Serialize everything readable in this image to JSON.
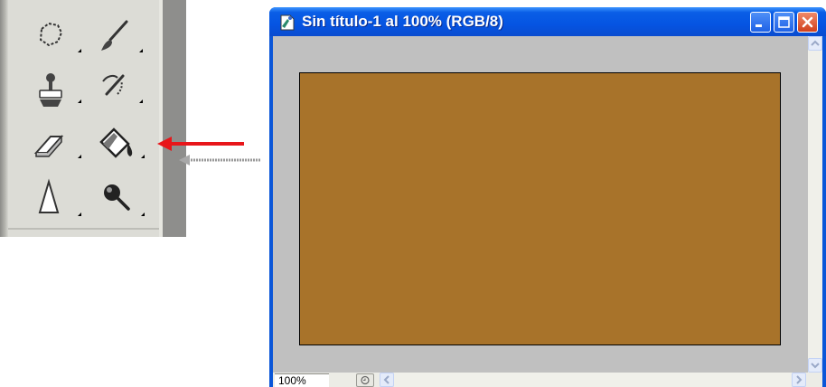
{
  "toolbox": {
    "tools": [
      {
        "icon": "polygon-lasso-icon",
        "has_submenu": true
      },
      {
        "icon": "brush-icon",
        "has_submenu": true
      },
      {
        "icon": "clone-stamp-icon",
        "has_submenu": true
      },
      {
        "icon": "history-brush-icon",
        "has_submenu": true
      },
      {
        "icon": "eraser-icon",
        "has_submenu": true
      },
      {
        "icon": "paint-bucket-icon",
        "has_submenu": true,
        "highlighted": true
      },
      {
        "icon": "blur-icon",
        "has_submenu": true
      },
      {
        "icon": "dodge-icon",
        "has_submenu": true
      }
    ]
  },
  "annotations": {
    "primary_arrow_color": "#e8161a",
    "secondary_arrow_color": "#9a9a9a"
  },
  "document_window": {
    "title": "Sin título-1 al 100% (RGB/8)",
    "controls": [
      "minimize-icon",
      "maximize-icon",
      "close-icon"
    ],
    "canvas_fill_color": "#a8732a",
    "workspace_color": "#c0c0c0",
    "status": {
      "zoom": "100%"
    }
  }
}
